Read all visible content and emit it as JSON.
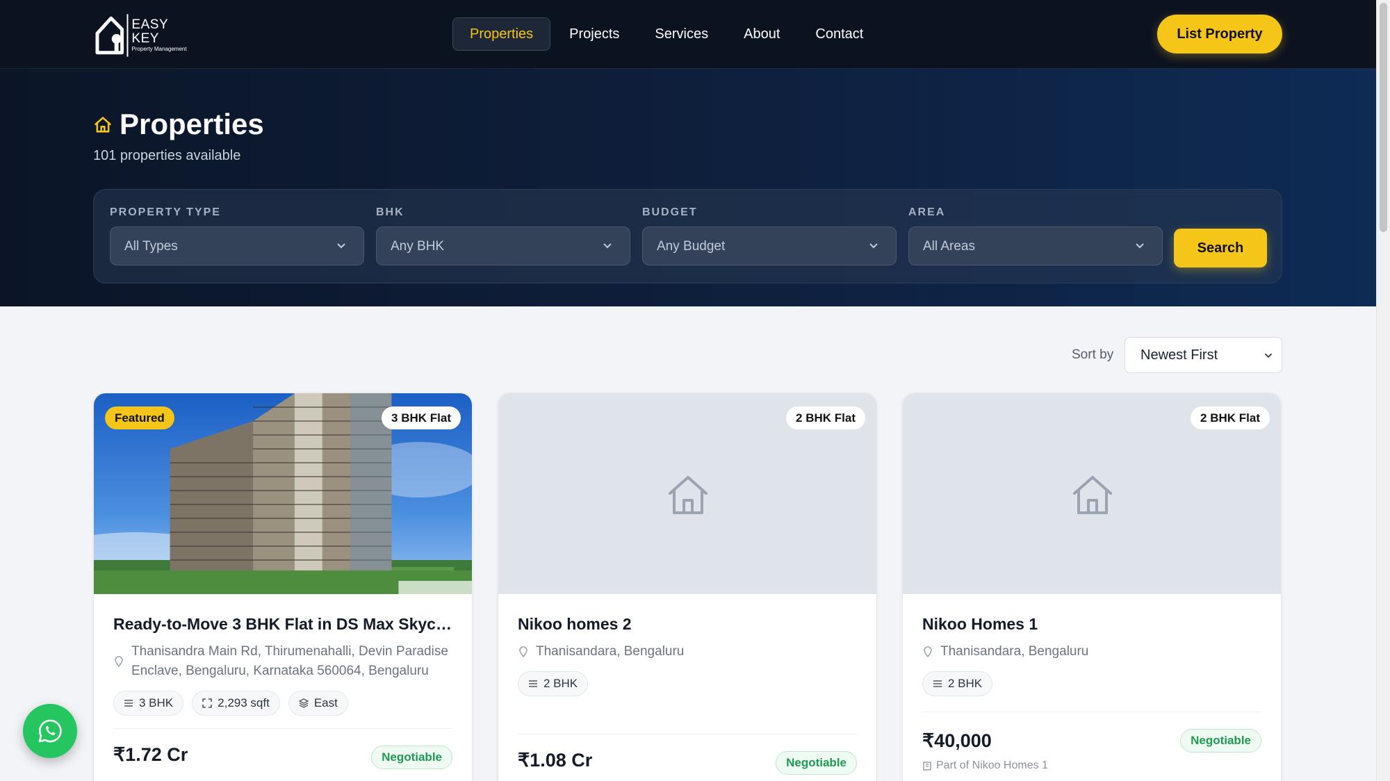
{
  "brand": {
    "name": "EASY KEY",
    "tagline": "Property Management"
  },
  "nav": {
    "links": [
      {
        "label": "Properties",
        "active": true
      },
      {
        "label": "Projects"
      },
      {
        "label": "Services"
      },
      {
        "label": "About"
      },
      {
        "label": "Contact"
      }
    ],
    "cta": "List Property"
  },
  "hero": {
    "title": "Properties",
    "subtitle": "101 properties available"
  },
  "filters": {
    "type": {
      "label": "PROPERTY TYPE",
      "value": "All Types"
    },
    "bhk": {
      "label": "BHK",
      "value": "Any BHK"
    },
    "budget": {
      "label": "BUDGET",
      "value": "Any Budget"
    },
    "area": {
      "label": "AREA",
      "value": "All Areas"
    },
    "search_label": "Search"
  },
  "sort": {
    "label": "Sort by",
    "value": "Newest First"
  },
  "cards": [
    {
      "featured": "Featured",
      "type": "3 BHK Flat",
      "title": "Ready-to-Move 3 BHK Flat in DS Max Skycit...",
      "location": "Thanisandra Main Rd, Thirumenahalli, Devin Paradise Enclave, Bengaluru, Karnataka 560064, Bengaluru",
      "bhk": "3 BHK",
      "area": "2,293 sqft",
      "facing": "East",
      "price": "₹1.72 Cr",
      "negotiable": "Negotiable"
    },
    {
      "type": "2 BHK Flat",
      "title": "Nikoo homes 2",
      "location": "Thanisandara, Bengaluru",
      "bhk": "2 BHK",
      "price": "₹1.08 Cr",
      "negotiable": "Negotiable"
    },
    {
      "type": "2 BHK Flat",
      "title": "Nikoo Homes 1",
      "location": "Thanisandara, Bengaluru",
      "bhk": "2 BHK",
      "price": "₹40,000",
      "negotiable": "Negotiable",
      "project": "Part of Nikoo Homes 1"
    }
  ],
  "colors": {
    "accent": "#f5c518",
    "nav_bg": "#0b1220",
    "negotiable": "#1f9a52",
    "whatsapp": "#25c660"
  },
  "icons": [
    "home-icon",
    "chevron-down-icon",
    "location-pin-icon",
    "bed-icon",
    "area-icon",
    "compass-icon",
    "building-icon",
    "whatsapp-icon"
  ]
}
